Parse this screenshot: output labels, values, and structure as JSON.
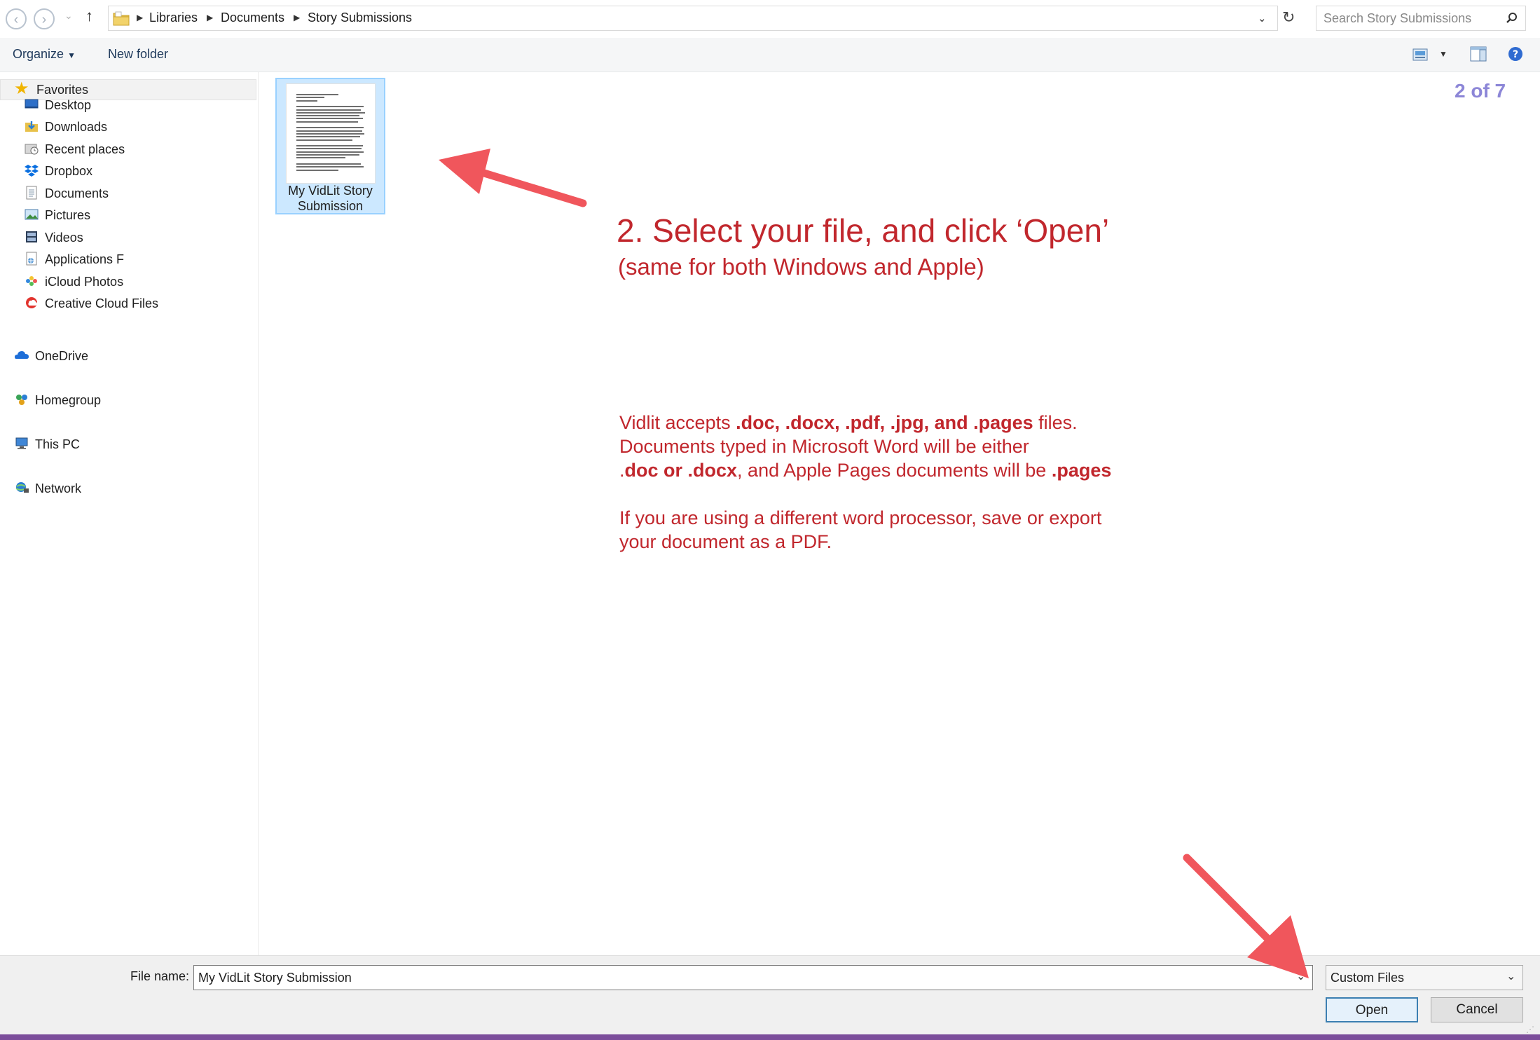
{
  "nav": {
    "back": "‹",
    "forward": "›",
    "recent": "⌄",
    "up": "↑"
  },
  "breadcrumb": [
    "Libraries",
    "Documents",
    "Story Submissions"
  ],
  "search": {
    "placeholder": "Search Story Submissions"
  },
  "toolbar": {
    "organize": "Organize",
    "new_folder": "New folder"
  },
  "sidebar": {
    "favorites": {
      "label": "Favorites",
      "items": [
        {
          "label": "Desktop",
          "icon": "desktop-icon"
        },
        {
          "label": "Downloads",
          "icon": "downloads-icon"
        },
        {
          "label": "Recent places",
          "icon": "recent-places-icon"
        },
        {
          "label": "Dropbox",
          "icon": "dropbox-icon"
        },
        {
          "label": "Documents",
          "icon": "documents-icon"
        },
        {
          "label": "Pictures",
          "icon": "pictures-icon"
        },
        {
          "label": "Videos",
          "icon": "videos-icon"
        },
        {
          "label": "Applications F",
          "icon": "applications-icon"
        },
        {
          "label": "iCloud Photos",
          "icon": "icloud-photos-icon"
        },
        {
          "label": "Creative Cloud Files",
          "icon": "creative-cloud-icon"
        }
      ]
    },
    "groups": [
      {
        "label": "OneDrive",
        "icon": "onedrive-icon"
      },
      {
        "label": "Homegroup",
        "icon": "homegroup-icon"
      },
      {
        "label": "This PC",
        "icon": "this-pc-icon"
      },
      {
        "label": "Network",
        "icon": "network-icon"
      }
    ]
  },
  "file": {
    "name_line1": "My VidLit Story",
    "name_line2": "Submission"
  },
  "annotation": {
    "title": "2. Select your file, and click ‘Open’",
    "subtitle": "(same for both Windows and Apple)",
    "para1_a": "Vidlit accepts ",
    "para1_b": ".doc, .docx, .pdf, .jpg, and .pages",
    "para1_c": " files.",
    "para2": "Documents typed in Microsoft Word will be either",
    "para3_a": ".",
    "para3_b": "doc or .docx",
    "para3_c": ", and Apple Pages documents will be ",
    "para3_d": ".pages",
    "para4": "If you are using a different word processor, save or export",
    "para5": "your document as a PDF."
  },
  "pager": "2 of 7",
  "footer": {
    "filename_label": "File name:",
    "filename_value": "My VidLit Story Submission",
    "filetype": "Custom Files",
    "open": "Open",
    "cancel": "Cancel"
  },
  "colors": {
    "annotation": "#c1272d",
    "arrow": "#f0565c",
    "pager": "#8c86d7",
    "selection": "#cce8ff",
    "accent_strip": "#7b4d9a"
  }
}
